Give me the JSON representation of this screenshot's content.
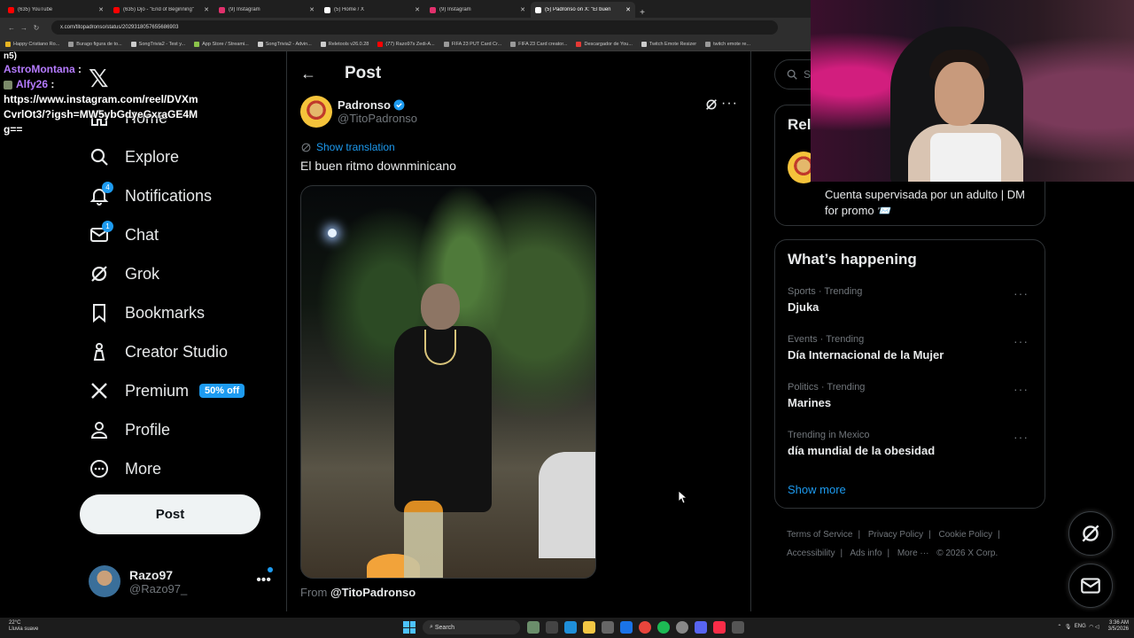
{
  "browser": {
    "tabs": [
      {
        "label": "(635) YouTube",
        "color": "#ff0000"
      },
      {
        "label": "(635) Djo - \"End of Beginning\"",
        "color": "#ff0000"
      },
      {
        "label": "(9) Instagram",
        "color": "#e1306c"
      },
      {
        "label": "(5) Home / X",
        "color": "#ffffff"
      },
      {
        "label": "(9) Instagram",
        "color": "#e1306c"
      },
      {
        "label": "(5) Padronso on X: \"El buen",
        "color": "#ffffff",
        "active": true
      }
    ],
    "url": "x.com/titopadronso/status/2029318057655686903",
    "bookmarks": [
      "Happy Cristiano Ro...",
      "Burago figura de to...",
      "SongTrivia2 - Test y...",
      "App Store / Streami...",
      "SongTrivia2 - Advin...",
      "Reletools v26.0.28",
      "(77) Razo97s Zedi-A...",
      "FIFA 23 PUT Card Cr...",
      "FIFA 23 Card creator...",
      "Descargador de You...",
      "Twitch Emote Resizer",
      "twitch emote re..."
    ]
  },
  "chat": {
    "first_line": "n5)",
    "messages": [
      {
        "user": "AstroMontana",
        "text": ""
      },
      {
        "user": "Alfy26",
        "text": "https://www.instagram.com/reel/DVXmCvrlOt3/?igsh=MW5ybGdyeGxraGE4Mg=="
      }
    ]
  },
  "nav": {
    "items": [
      {
        "label": "Home",
        "icon": "home-icon"
      },
      {
        "label": "Explore",
        "icon": "search-icon",
        "badge": ""
      },
      {
        "label": "Notifications",
        "icon": "bell-icon",
        "badge": "4"
      },
      {
        "label": "Chat",
        "icon": "mail-icon",
        "badge": "1"
      },
      {
        "label": "Grok",
        "icon": "grok-icon"
      },
      {
        "label": "Bookmarks",
        "icon": "bookmark-icon"
      },
      {
        "label": "Creator Studio",
        "icon": "creator-studio-icon"
      },
      {
        "label": "Premium",
        "icon": "x-logo-icon",
        "badge_text": "50% off"
      },
      {
        "label": "Profile",
        "icon": "person-icon"
      },
      {
        "label": "More",
        "icon": "more-circle-icon"
      }
    ],
    "post_button": "Post",
    "account": {
      "name": "Razo97",
      "handle": "@Razo97_"
    }
  },
  "post": {
    "header_title": "Post",
    "author_name": "Padronso",
    "author_handle": "@TitoPadronso",
    "translate_label": "Show translation",
    "text": "El buen ritmo downminicano",
    "from_prefix": "From",
    "from_handle": "@TitoPadronso"
  },
  "right": {
    "search_placeholder": "Se",
    "relevant_title": "Rel",
    "relevant_bio": "Cuenta supervisada por un adulto | DM for promo 📨",
    "happening_title": "What’s happening",
    "trends": [
      {
        "meta": "Sports · Trending",
        "name": "Djuka"
      },
      {
        "meta": "Events · Trending",
        "name": "Día Internacional de la Mujer"
      },
      {
        "meta": "Politics · Trending",
        "name": "Marines"
      },
      {
        "meta": "Trending in Mexico",
        "name": "día mundial de la obesidad"
      }
    ],
    "show_more": "Show more",
    "footer": [
      "Terms of Service",
      "|",
      "Privacy Policy",
      "|",
      "Cookie Policy",
      "|",
      "Accessibility",
      "|",
      "Ads info",
      "|",
      "More ···",
      "© 2026 X Corp."
    ]
  },
  "taskbar": {
    "weather_temp": "22°C",
    "weather_desc": "Lluvia suave",
    "search": "Search",
    "lang": "ENG",
    "time": "3:36 AM",
    "date": "3/5/2026"
  },
  "colors": {
    "accent": "#1d9bf0",
    "background": "#000000",
    "border": "#2f3336",
    "muted": "#71767b"
  }
}
